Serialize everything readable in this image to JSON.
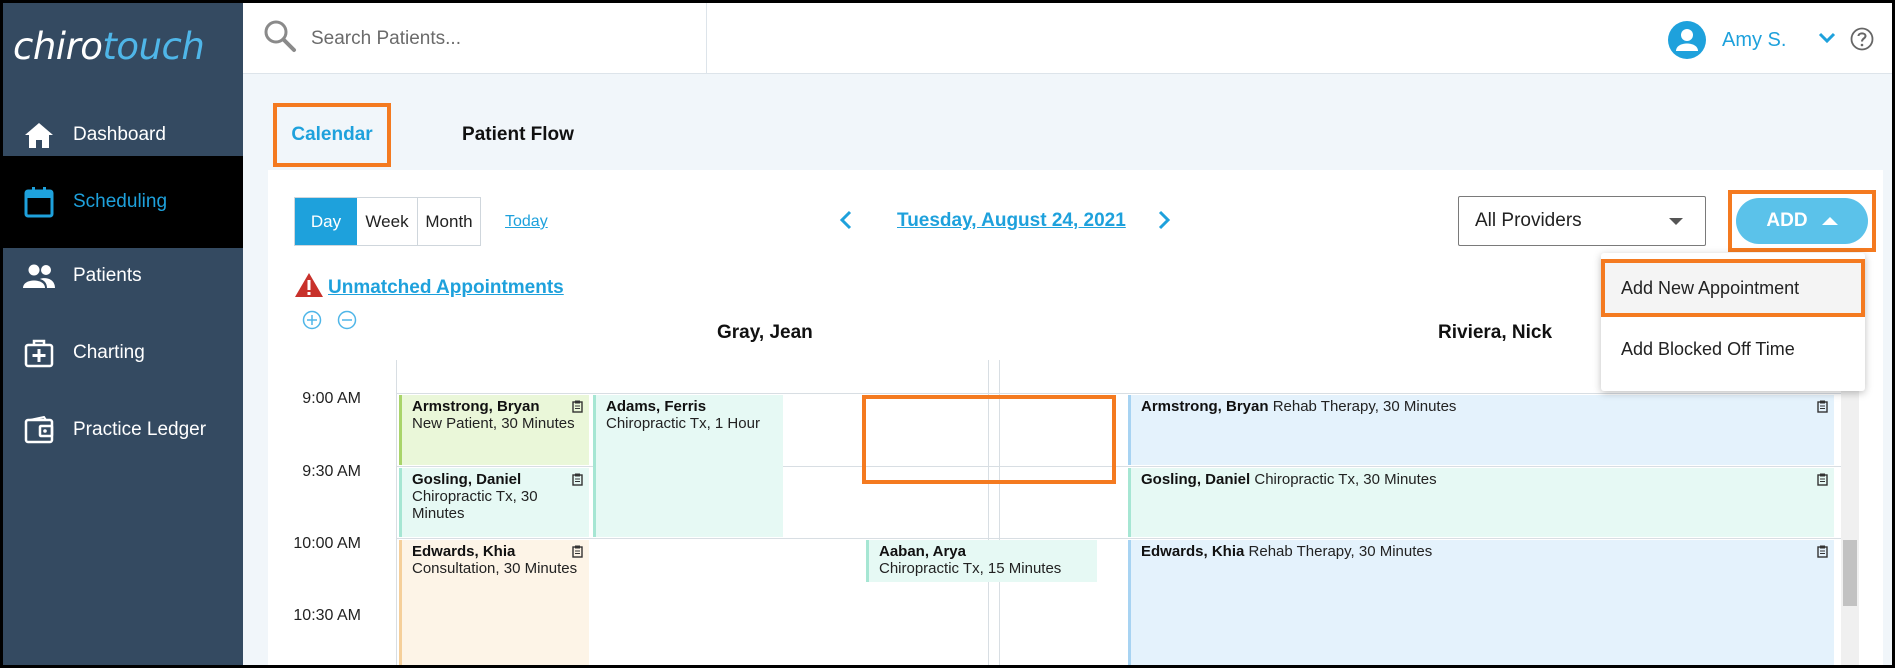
{
  "app": {
    "logo_part1": "chiro",
    "logo_part2": "touch"
  },
  "sidebar": {
    "items": [
      {
        "label": "Dashboard",
        "icon": "home-icon",
        "active": false
      },
      {
        "label": "Scheduling",
        "icon": "calendar-icon",
        "active": true
      },
      {
        "label": "Patients",
        "icon": "people-icon",
        "active": false
      },
      {
        "label": "Charting",
        "icon": "medical-case-icon",
        "active": false
      },
      {
        "label": "Practice Ledger",
        "icon": "wallet-icon",
        "active": false
      }
    ]
  },
  "topbar": {
    "search_placeholder": "Search Patients...",
    "user_name": "Amy S."
  },
  "tabs": {
    "calendar": "Calendar",
    "patient_flow": "Patient Flow"
  },
  "toolbar": {
    "views": [
      "Day",
      "Week",
      "Month"
    ],
    "today": "Today",
    "date": "Tuesday, August 24, 2021",
    "providers_select": "All Providers",
    "add_label": "ADD"
  },
  "unmatched_label": "Unmatched Appointments",
  "providers": [
    "Gray, Jean",
    "Riviera, Nick"
  ],
  "times": [
    "9:00 AM",
    "9:30 AM",
    "10:00 AM",
    "10:30 AM"
  ],
  "appointments_gray": [
    {
      "name": "Armstrong, Bryan",
      "desc": "New Patient, 30 Minutes"
    },
    {
      "name": "Adams, Ferris",
      "desc": "Chiropractic Tx, 1 Hour"
    },
    {
      "name": "Gosling, Daniel",
      "desc": "Chiropractic Tx, 30 Minutes"
    },
    {
      "name": "Edwards, Khia",
      "desc": "Consultation, 30 Minutes"
    },
    {
      "name": "Aaban, Arya",
      "desc": "Chiropractic Tx, 15 Minutes"
    }
  ],
  "appointments_riviera": [
    {
      "name": "Armstrong, Bryan",
      "desc": " Rehab Therapy, 30 Minutes"
    },
    {
      "name": "Gosling, Daniel",
      "desc": " Chiropractic Tx, 30 Minutes"
    },
    {
      "name": "Edwards, Khia",
      "desc": " Rehab Therapy, 30 Minutes"
    }
  ],
  "add_menu": [
    "Add New Appointment",
    "Add Blocked Off Time"
  ],
  "colors": {
    "accent": "#1ea1dc",
    "sidebar": "#344a61",
    "highlight": "#f47a20"
  }
}
